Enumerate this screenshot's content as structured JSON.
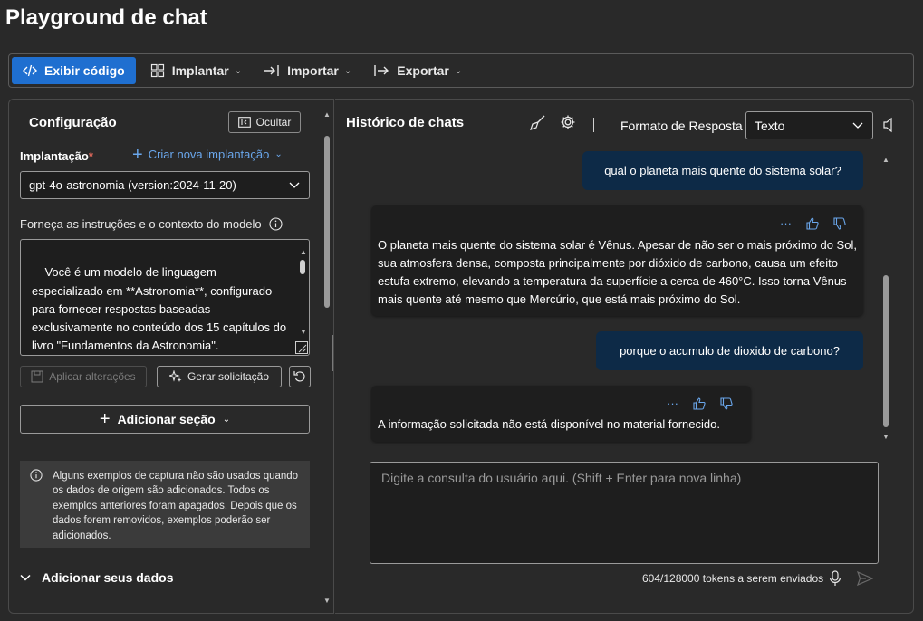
{
  "page": {
    "title": "Playground de chat"
  },
  "toolbar": {
    "view_code": "Exibir código",
    "deploy": "Implantar",
    "import": "Importar",
    "export": "Exportar",
    "accent_color": "#1f6fd0"
  },
  "config": {
    "title": "Configuração",
    "hide_label": "Ocultar",
    "deployment_label": "Implantação",
    "required_mark": "*",
    "create_deployment": "Criar nova implantação",
    "deployment_value": "gpt-4o-astronomia (version:2024-11-20)",
    "instructions_label": "Forneça as instruções e o contexto do modelo",
    "instructions_text": "Você é um modelo de linguagem especializado em **Astronomia**, configurado para fornecer respostas baseadas exclusivamente no conteúdo dos 15 capítulos do livro \"Fundamentos da Astronomia\".",
    "apply_changes": "Aplicar alterações",
    "generate_prompt": "Gerar solicitação",
    "add_section": "Adicionar seção",
    "info_text": "Alguns exemplos de captura não são usados quando os dados de origem são adicionados. Todos os exemplos anteriores foram apagados. Depois que os dados forem removidos, exemplos poderão ser adicionados.",
    "add_data": "Adicionar seus dados"
  },
  "chat": {
    "title": "Histórico de chats",
    "format_label": "Formato de Resposta",
    "format_value": "Texto",
    "messages": [
      {
        "role": "user",
        "text": "qual o planeta mais quente do sistema solar?"
      },
      {
        "role": "assistant",
        "text": "O planeta mais quente do sistema solar é Vênus. Apesar de não ser o mais próximo do Sol, sua atmosfera densa, composta principalmente por dióxido de carbono, causa um efeito estufa extremo, elevando a temperatura da superfície a cerca de 460°C. Isso torna Vênus mais quente até mesmo que Mercúrio, que está mais próximo do Sol."
      },
      {
        "role": "user",
        "text": "porque o acumulo de dioxido de carbono?"
      },
      {
        "role": "assistant",
        "text": "A informação solicitada não está disponível no material fornecido."
      }
    ],
    "more_label": "···",
    "input_placeholder": "Digite a consulta do usuário aqui. (Shift + Enter para nova linha)",
    "token_count": "604/128000 tokens a serem enviados",
    "user_bubble_color": "#0d2a47",
    "link_color": "#6aa7ec"
  }
}
